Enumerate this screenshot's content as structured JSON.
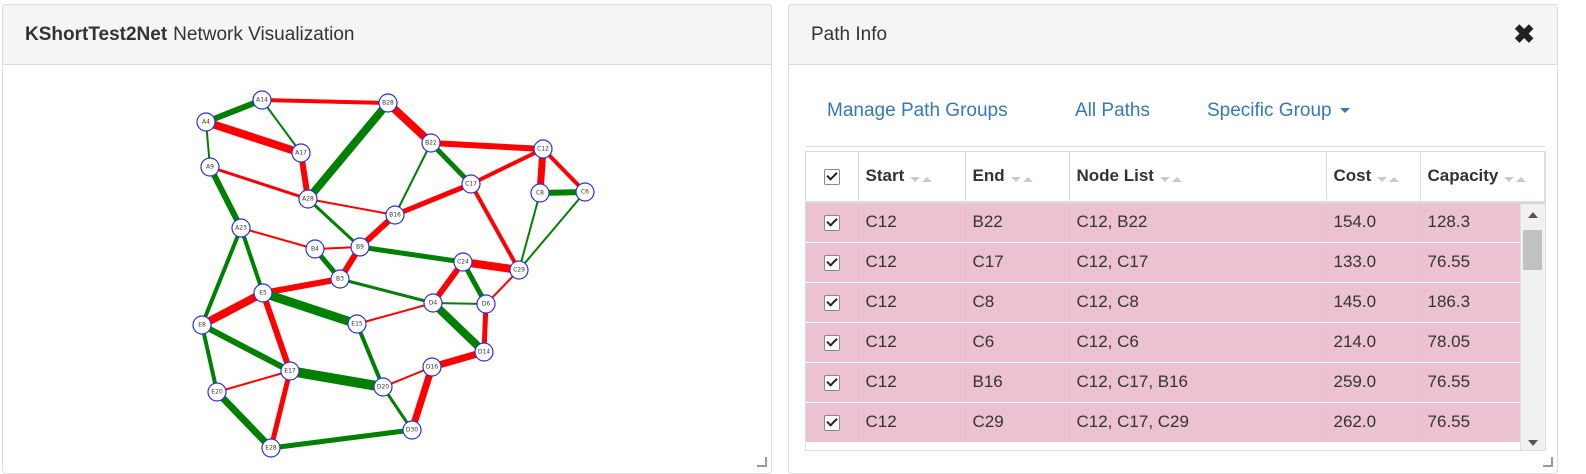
{
  "left_panel": {
    "title_bold": "KShortTest2Net",
    "title_rest": "Network Visualization"
  },
  "right_panel": {
    "title": "Path Info",
    "close_icon": "close-icon"
  },
  "tabs": [
    {
      "label": "Manage Path Groups"
    },
    {
      "label": "All Paths"
    },
    {
      "label": "Specific Group"
    }
  ],
  "table": {
    "columns": [
      "Start",
      "End",
      "Node List",
      "Cost",
      "Capacity"
    ],
    "rows": [
      {
        "checked": true,
        "start": "C12",
        "end": "B22",
        "node_list": "C12, B22",
        "cost": "154.0",
        "capacity": "128.3"
      },
      {
        "checked": true,
        "start": "C12",
        "end": "C17",
        "node_list": "C12, C17",
        "cost": "133.0",
        "capacity": "76.55"
      },
      {
        "checked": true,
        "start": "C12",
        "end": "C8",
        "node_list": "C12, C8",
        "cost": "145.0",
        "capacity": "186.3"
      },
      {
        "checked": true,
        "start": "C12",
        "end": "C6",
        "node_list": "C12, C6",
        "cost": "214.0",
        "capacity": "78.05"
      },
      {
        "checked": true,
        "start": "C12",
        "end": "B16",
        "node_list": "C12, C17, B16",
        "cost": "259.0",
        "capacity": "76.55"
      },
      {
        "checked": true,
        "start": "C12",
        "end": "C29",
        "node_list": "C12, C17, C29",
        "cost": "262.0",
        "capacity": "76.55"
      }
    ]
  },
  "network": {
    "colors": {
      "green": "#008000",
      "red": "#ff0000",
      "node_stroke": "#2a2ee6"
    },
    "nodes": [
      "A14",
      "B28",
      "A4",
      "B22",
      "A17",
      "C12",
      "A9",
      "C17",
      "C8",
      "C6",
      "A28",
      "B16",
      "A23",
      "B4",
      "B9",
      "C24",
      "C29",
      "B3",
      "E5",
      "D4",
      "D6",
      "E8",
      "E15",
      "D14",
      "D16",
      "E17",
      "D20",
      "E20",
      "D30",
      "E28"
    ],
    "edges": [
      {
        "from": "A4",
        "to": "A14",
        "color": "green",
        "weight": 6
      },
      {
        "from": "A14",
        "to": "B28",
        "color": "red",
        "weight": 4
      },
      {
        "from": "A14",
        "to": "A17",
        "color": "green",
        "weight": 2
      },
      {
        "from": "A4",
        "to": "A17",
        "color": "red",
        "weight": 8
      },
      {
        "from": "A4",
        "to": "A9",
        "color": "green",
        "weight": 2
      },
      {
        "from": "A17",
        "to": "A28",
        "color": "red",
        "weight": 6
      },
      {
        "from": "B28",
        "to": "A28",
        "color": "green",
        "weight": 8
      },
      {
        "from": "B28",
        "to": "B22",
        "color": "red",
        "weight": 8
      },
      {
        "from": "B22",
        "to": "C12",
        "color": "red",
        "weight": 6
      },
      {
        "from": "B22",
        "to": "C17",
        "color": "green",
        "weight": 5
      },
      {
        "from": "B22",
        "to": "B16",
        "color": "green",
        "weight": 2
      },
      {
        "from": "C12",
        "to": "C17",
        "color": "red",
        "weight": 4
      },
      {
        "from": "C12",
        "to": "C8",
        "color": "red",
        "weight": 7
      },
      {
        "from": "C12",
        "to": "C6",
        "color": "red",
        "weight": 4
      },
      {
        "from": "C8",
        "to": "C6",
        "color": "green",
        "weight": 6
      },
      {
        "from": "C8",
        "to": "C29",
        "color": "green",
        "weight": 2
      },
      {
        "from": "C6",
        "to": "C29",
        "color": "green",
        "weight": 2
      },
      {
        "from": "A9",
        "to": "A28",
        "color": "red",
        "weight": 3
      },
      {
        "from": "A9",
        "to": "A23",
        "color": "green",
        "weight": 6
      },
      {
        "from": "A28",
        "to": "B16",
        "color": "red",
        "weight": 2
      },
      {
        "from": "A28",
        "to": "B9",
        "color": "green",
        "weight": 3
      },
      {
        "from": "B16",
        "to": "C17",
        "color": "red",
        "weight": 5
      },
      {
        "from": "B16",
        "to": "B9",
        "color": "red",
        "weight": 6
      },
      {
        "from": "C17",
        "to": "C29",
        "color": "red",
        "weight": 4
      },
      {
        "from": "A23",
        "to": "B4",
        "color": "red",
        "weight": 2
      },
      {
        "from": "A23",
        "to": "E5",
        "color": "green",
        "weight": 4
      },
      {
        "from": "A23",
        "to": "E8",
        "color": "green",
        "weight": 4
      },
      {
        "from": "B4",
        "to": "B9",
        "color": "red",
        "weight": 2
      },
      {
        "from": "B4",
        "to": "B3",
        "color": "green",
        "weight": 5
      },
      {
        "from": "B9",
        "to": "B3",
        "color": "red",
        "weight": 6
      },
      {
        "from": "B9",
        "to": "C24",
        "color": "green",
        "weight": 5
      },
      {
        "from": "C24",
        "to": "C29",
        "color": "red",
        "weight": 8
      },
      {
        "from": "C24",
        "to": "D4",
        "color": "red",
        "weight": 6
      },
      {
        "from": "C24",
        "to": "D6",
        "color": "green",
        "weight": 5
      },
      {
        "from": "C29",
        "to": "D6",
        "color": "red",
        "weight": 2
      },
      {
        "from": "B3",
        "to": "E5",
        "color": "red",
        "weight": 6
      },
      {
        "from": "B3",
        "to": "D4",
        "color": "green",
        "weight": 3
      },
      {
        "from": "D4",
        "to": "D6",
        "color": "green",
        "weight": 2
      },
      {
        "from": "D4",
        "to": "D14",
        "color": "green",
        "weight": 8
      },
      {
        "from": "D6",
        "to": "D14",
        "color": "red",
        "weight": 5
      },
      {
        "from": "E5",
        "to": "E8",
        "color": "red",
        "weight": 8
      },
      {
        "from": "E5",
        "to": "E15",
        "color": "green",
        "weight": 9
      },
      {
        "from": "E5",
        "to": "E17",
        "color": "red",
        "weight": 6
      },
      {
        "from": "E15",
        "to": "D4",
        "color": "red",
        "weight": 2
      },
      {
        "from": "E15",
        "to": "D20",
        "color": "green",
        "weight": 4
      },
      {
        "from": "D14",
        "to": "D16",
        "color": "red",
        "weight": 7
      },
      {
        "from": "D16",
        "to": "D20",
        "color": "red",
        "weight": 2
      },
      {
        "from": "D16",
        "to": "D30",
        "color": "red",
        "weight": 7
      },
      {
        "from": "E8",
        "to": "E17",
        "color": "green",
        "weight": 6
      },
      {
        "from": "E8",
        "to": "E20",
        "color": "green",
        "weight": 4
      },
      {
        "from": "E17",
        "to": "D20",
        "color": "green",
        "weight": 10
      },
      {
        "from": "E17",
        "to": "E20",
        "color": "red",
        "weight": 2
      },
      {
        "from": "E17",
        "to": "E28",
        "color": "red",
        "weight": 5
      },
      {
        "from": "D20",
        "to": "D30",
        "color": "green",
        "weight": 3
      },
      {
        "from": "E20",
        "to": "E28",
        "color": "green",
        "weight": 7
      },
      {
        "from": "E28",
        "to": "D30",
        "color": "green",
        "weight": 5
      }
    ]
  }
}
